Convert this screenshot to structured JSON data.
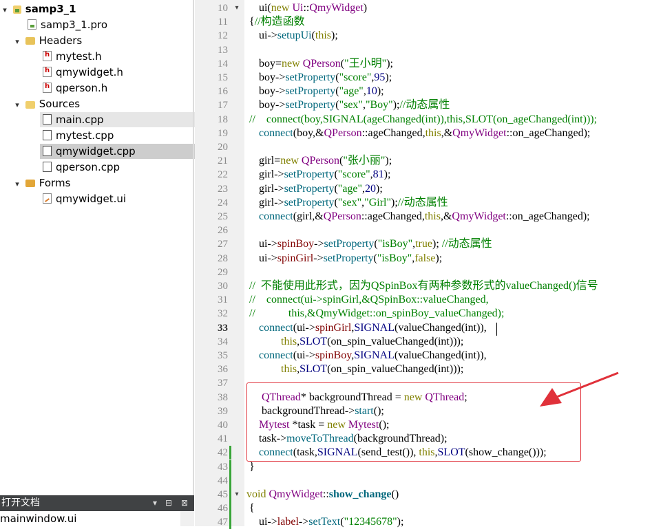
{
  "tree": {
    "project": "samp3_1",
    "pro_file": "samp3_1.pro",
    "headers_label": "Headers",
    "headers": [
      "mytest.h",
      "qmywidget.h",
      "qperson.h"
    ],
    "sources_label": "Sources",
    "sources": [
      "main.cpp",
      "mytest.cpp",
      "qmywidget.cpp",
      "qperson.cpp"
    ],
    "forms_label": "Forms",
    "forms": [
      "qmywidget.ui"
    ]
  },
  "open_docs": {
    "title": "打开文档",
    "items": [
      "mainwindow.ui"
    ]
  },
  "editor": {
    "line_numbers": [
      10,
      11,
      12,
      13,
      14,
      15,
      16,
      17,
      18,
      19,
      20,
      21,
      22,
      23,
      24,
      25,
      26,
      27,
      28,
      29,
      30,
      31,
      32,
      33,
      34,
      35,
      36,
      37,
      38,
      39,
      40,
      41,
      42,
      43,
      44,
      45,
      46,
      47
    ],
    "lines": [
      "ui(new Ui::QmyWidget)",
      "{//构造函数",
      "ui->setupUi(this);",
      "",
      "boy=new QPerson(\"王小明\");",
      "boy->setProperty(\"score\",95);",
      "boy->setProperty(\"age\",10);",
      "boy->setProperty(\"sex\",\"Boy\");//动态属性",
      "//    connect(boy,SIGNAL(ageChanged(int)),this,SLOT(on_ageChanged(int)));",
      "connect(boy,&QPerson::ageChanged,this,&QmyWidget::on_ageChanged);",
      "",
      "girl=new QPerson(\"张小丽\");",
      "girl->setProperty(\"score\",81);",
      "girl->setProperty(\"age\",20);",
      "girl->setProperty(\"sex\",\"Girl\");//动态属性",
      "connect(girl,&QPerson::ageChanged,this,&QmyWidget::on_ageChanged);",
      "",
      "ui->spinBoy->setProperty(\"isBoy\",true); //动态属性",
      "ui->spinGirl->setProperty(\"isBoy\",false);",
      "",
      "//  不能使用此形式，因为QSpinBox有两种参数形式的valueChanged()信号",
      "//    connect(ui->spinGirl,&QSpinBox::valueChanged,",
      "//            this,&QmyWidget::on_spinBoy_valueChanged);",
      "connect(ui->spinGirl,SIGNAL(valueChanged(int)),",
      "this,SLOT(on_spin_valueChanged(int)));",
      "connect(ui->spinBoy,SIGNAL(valueChanged(int)),",
      "this,SLOT(on_spin_valueChanged(int)));",
      "",
      "QThread* backgroundThread = new QThread;",
      "backgroundThread->start();",
      "Mytest *task = new Mytest();",
      "task->moveToThread(backgroundThread);",
      "connect(task,SIGNAL(send_test()), this,SLOT(show_change()));",
      "}",
      "",
      "void QmyWidget::show_change()",
      "{",
      "ui->label->setText(\"12345678\");"
    ]
  },
  "colors": {
    "keyword": "#808000",
    "type": "#800080",
    "function": "#00677c",
    "string": "#008000",
    "comment": "#008000",
    "annotation_box": "#e0313a",
    "annotation_arrow": "#e0313a"
  }
}
